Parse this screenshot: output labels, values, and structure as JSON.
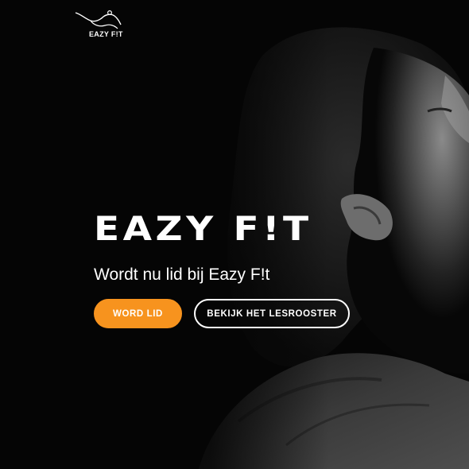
{
  "brand": {
    "logo_text": "EAZY F!T",
    "logo_icon": "flexing-athlete-icon"
  },
  "hero": {
    "title": "EAZY F!T",
    "subtitle": "Wordt nu lid bij Eazy F!t",
    "primary_button": "WORD LID",
    "secondary_button": "BEKIJK HET LESROOSTER"
  },
  "colors": {
    "background": "#050505",
    "accent": "#f7931e",
    "text": "#ffffff"
  }
}
